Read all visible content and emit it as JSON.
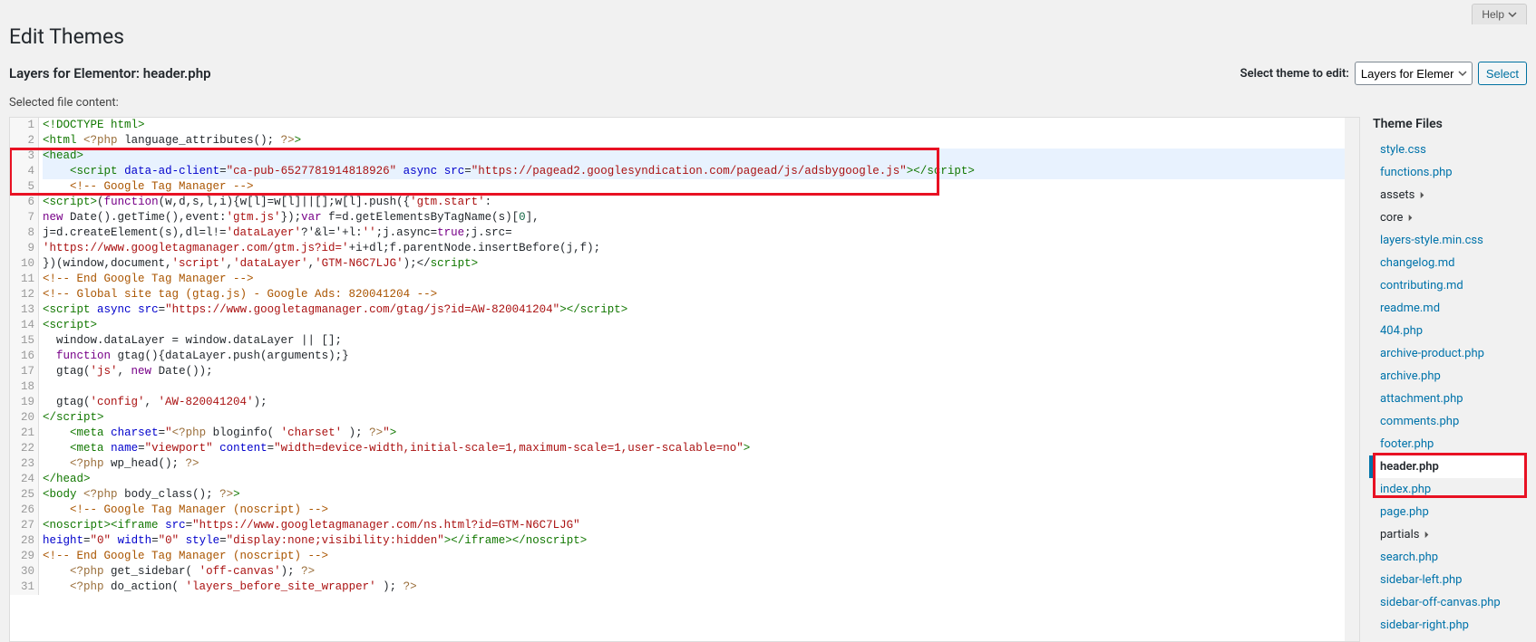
{
  "topbar": {
    "help": "Help"
  },
  "page": {
    "title": "Edit Themes",
    "subtitle": "Layers for Elementor: header.php",
    "select_label": "Select theme to edit:",
    "select_value": "Layers for Elemer",
    "select_button": "Select",
    "content_label": "Selected file content:"
  },
  "sidebar": {
    "title": "Theme Files",
    "files": [
      {
        "name": "style.css",
        "type": "file"
      },
      {
        "name": "functions.php",
        "type": "file"
      },
      {
        "name": "assets",
        "type": "folder"
      },
      {
        "name": "core",
        "type": "folder"
      },
      {
        "name": "layers-style.min.css",
        "type": "file"
      },
      {
        "name": "changelog.md",
        "type": "file"
      },
      {
        "name": "contributing.md",
        "type": "file"
      },
      {
        "name": "readme.md",
        "type": "file"
      },
      {
        "name": "404.php",
        "type": "file"
      },
      {
        "name": "archive-product.php",
        "type": "file"
      },
      {
        "name": "archive.php",
        "type": "file"
      },
      {
        "name": "attachment.php",
        "type": "file"
      },
      {
        "name": "comments.php",
        "type": "file"
      },
      {
        "name": "footer.php",
        "type": "file"
      },
      {
        "name": "header.php",
        "type": "file",
        "active": true
      },
      {
        "name": "index.php",
        "type": "file"
      },
      {
        "name": "page.php",
        "type": "file"
      },
      {
        "name": "partials",
        "type": "folder"
      },
      {
        "name": "search.php",
        "type": "file"
      },
      {
        "name": "sidebar-left.php",
        "type": "file"
      },
      {
        "name": "sidebar-off-canvas.php",
        "type": "file"
      },
      {
        "name": "sidebar-right.php",
        "type": "file"
      }
    ]
  },
  "code": {
    "lines": [
      {
        "n": 1,
        "hl": false,
        "tokens": [
          [
            "<!DOCTYPE html>",
            "cm-tag"
          ]
        ]
      },
      {
        "n": 2,
        "hl": false,
        "tokens": [
          [
            "<",
            "cm-bracket"
          ],
          [
            "html",
            "cm-tag"
          ],
          [
            " ",
            ""
          ],
          [
            "<?php",
            "cm-php"
          ],
          [
            " language_attributes(); ",
            ""
          ],
          [
            "?>",
            "cm-php"
          ],
          [
            ">",
            "cm-bracket"
          ]
        ]
      },
      {
        "n": 3,
        "hl": true,
        "tokens": [
          [
            "<",
            "cm-bracket"
          ],
          [
            "head",
            "cm-tag"
          ],
          [
            ">",
            "cm-bracket"
          ]
        ]
      },
      {
        "n": 4,
        "hl": true,
        "tokens": [
          [
            "    ",
            ""
          ],
          [
            "<",
            "cm-bracket"
          ],
          [
            "script",
            "cm-tag"
          ],
          [
            " ",
            ""
          ],
          [
            "data-ad-client",
            "cm-attr"
          ],
          [
            "=",
            ""
          ],
          [
            "\"ca-pub-6527781914818926\"",
            "cm-string"
          ],
          [
            " ",
            ""
          ],
          [
            "async",
            "cm-attr"
          ],
          [
            " ",
            ""
          ],
          [
            "src",
            "cm-attr"
          ],
          [
            "=",
            ""
          ],
          [
            "\"https://pagead2.googlesyndication.com/pagead/js/adsbygoogle.js\"",
            "cm-string"
          ],
          [
            "></",
            "cm-bracket"
          ],
          [
            "script",
            "cm-tag"
          ],
          [
            ">",
            "cm-bracket"
          ]
        ]
      },
      {
        "n": 5,
        "hl": false,
        "tokens": [
          [
            "    ",
            ""
          ],
          [
            "<!-- Google Tag Manager -->",
            "cm-comment"
          ]
        ]
      },
      {
        "n": 6,
        "hl": false,
        "tokens": [
          [
            "<",
            "cm-bracket"
          ],
          [
            "script",
            "cm-tag"
          ],
          [
            ">",
            "cm-bracket"
          ],
          [
            "(",
            ""
          ],
          [
            "function",
            "cm-kw"
          ],
          [
            "(w,d,s,l,i){w[l]=w[l]||[];w[l].push({",
            ""
          ],
          [
            "'gtm.start'",
            "cm-string"
          ],
          [
            ":",
            ""
          ]
        ]
      },
      {
        "n": 7,
        "hl": false,
        "tokens": [
          [
            "new",
            "cm-kw"
          ],
          [
            " Date().getTime(),event:",
            ""
          ],
          [
            "'gtm.js'",
            "cm-string"
          ],
          [
            "});",
            ""
          ],
          [
            "var",
            "cm-kw"
          ],
          [
            " f=d.getElementsByTagName(s)[",
            ""
          ],
          [
            "0",
            "cm-num"
          ],
          [
            "],",
            ""
          ]
        ]
      },
      {
        "n": 8,
        "hl": false,
        "tokens": [
          [
            "j=d.createElement(s),dl=l!=",
            ""
          ],
          [
            "'dataLayer'",
            "cm-string"
          ],
          [
            "?'&l='+l:",
            ""
          ],
          [
            "''",
            "cm-string"
          ],
          [
            ";j.async=",
            ""
          ],
          [
            "true",
            "cm-kw"
          ],
          [
            ";j.src=",
            ""
          ]
        ]
      },
      {
        "n": 9,
        "hl": false,
        "tokens": [
          [
            "'https://www.googletagmanager.com/gtm.js?id='",
            "cm-string"
          ],
          [
            "+i+dl;f.parentNode.insertBefore(j,f);",
            ""
          ]
        ]
      },
      {
        "n": 10,
        "hl": false,
        "tokens": [
          [
            "})(window,document,",
            ""
          ],
          [
            "'script'",
            "cm-string"
          ],
          [
            ",",
            ""
          ],
          [
            "'dataLayer'",
            "cm-string"
          ],
          [
            ",",
            ""
          ],
          [
            "'GTM-N6C7LJG'",
            "cm-string"
          ],
          [
            ");</",
            ""
          ],
          [
            "script",
            "cm-tag"
          ],
          [
            ">",
            "cm-bracket"
          ]
        ]
      },
      {
        "n": 11,
        "hl": false,
        "tokens": [
          [
            "<!-- End Google Tag Manager -->",
            "cm-comment"
          ]
        ]
      },
      {
        "n": 12,
        "hl": false,
        "tokens": [
          [
            "<!-- Global site tag (gtag.js) - Google Ads: 820041204 -->",
            "cm-comment"
          ]
        ]
      },
      {
        "n": 13,
        "hl": false,
        "tokens": [
          [
            "<",
            "cm-bracket"
          ],
          [
            "script",
            "cm-tag"
          ],
          [
            " ",
            ""
          ],
          [
            "async",
            "cm-attr"
          ],
          [
            " ",
            ""
          ],
          [
            "src",
            "cm-attr"
          ],
          [
            "=",
            ""
          ],
          [
            "\"https://www.googletagmanager.com/gtag/js?id=AW-820041204\"",
            "cm-string"
          ],
          [
            "></",
            "cm-bracket"
          ],
          [
            "script",
            "cm-tag"
          ],
          [
            ">",
            "cm-bracket"
          ]
        ]
      },
      {
        "n": 14,
        "hl": false,
        "tokens": [
          [
            "<",
            "cm-bracket"
          ],
          [
            "script",
            "cm-tag"
          ],
          [
            ">",
            "cm-bracket"
          ]
        ]
      },
      {
        "n": 15,
        "hl": false,
        "tokens": [
          [
            "  window.dataLayer = window.dataLayer || [];",
            ""
          ]
        ]
      },
      {
        "n": 16,
        "hl": false,
        "tokens": [
          [
            "  ",
            ""
          ],
          [
            "function",
            "cm-kw"
          ],
          [
            " gtag(){dataLayer.push(arguments);}",
            ""
          ]
        ]
      },
      {
        "n": 17,
        "hl": false,
        "tokens": [
          [
            "  gtag(",
            ""
          ],
          [
            "'js'",
            "cm-string"
          ],
          [
            ", ",
            ""
          ],
          [
            "new",
            "cm-kw"
          ],
          [
            " Date());",
            ""
          ]
        ]
      },
      {
        "n": 18,
        "hl": false,
        "tokens": [
          [
            "",
            ""
          ]
        ]
      },
      {
        "n": 19,
        "hl": false,
        "tokens": [
          [
            "  gtag(",
            ""
          ],
          [
            "'config'",
            "cm-string"
          ],
          [
            ", ",
            ""
          ],
          [
            "'AW-820041204'",
            "cm-string"
          ],
          [
            ");",
            ""
          ]
        ]
      },
      {
        "n": 20,
        "hl": false,
        "tokens": [
          [
            "</",
            "cm-bracket"
          ],
          [
            "script",
            "cm-tag"
          ],
          [
            ">",
            "cm-bracket"
          ]
        ]
      },
      {
        "n": 21,
        "hl": false,
        "tokens": [
          [
            "    ",
            ""
          ],
          [
            "<",
            "cm-bracket"
          ],
          [
            "meta",
            "cm-tag"
          ],
          [
            " ",
            ""
          ],
          [
            "charset",
            "cm-attr"
          ],
          [
            "=",
            ""
          ],
          [
            "\"",
            "cm-string"
          ],
          [
            "<?php",
            "cm-php"
          ],
          [
            " bloginfo( ",
            ""
          ],
          [
            "'charset'",
            "cm-string"
          ],
          [
            " ); ",
            ""
          ],
          [
            "?>",
            "cm-php"
          ],
          [
            "\"",
            "cm-string"
          ],
          [
            ">",
            "cm-bracket"
          ]
        ]
      },
      {
        "n": 22,
        "hl": false,
        "tokens": [
          [
            "    ",
            ""
          ],
          [
            "<",
            "cm-bracket"
          ],
          [
            "meta",
            "cm-tag"
          ],
          [
            " ",
            ""
          ],
          [
            "name",
            "cm-attr"
          ],
          [
            "=",
            ""
          ],
          [
            "\"viewport\"",
            "cm-string"
          ],
          [
            " ",
            ""
          ],
          [
            "content",
            "cm-attr"
          ],
          [
            "=",
            ""
          ],
          [
            "\"width=device-width,initial-scale=1,maximum-scale=1,user-scalable=no\"",
            "cm-string"
          ],
          [
            ">",
            "cm-bracket"
          ]
        ]
      },
      {
        "n": 23,
        "hl": false,
        "tokens": [
          [
            "    ",
            ""
          ],
          [
            "<?php",
            "cm-php"
          ],
          [
            " wp_head(); ",
            ""
          ],
          [
            "?>",
            "cm-php"
          ]
        ]
      },
      {
        "n": 24,
        "hl": false,
        "tokens": [
          [
            "</",
            "cm-bracket"
          ],
          [
            "head",
            "cm-tag"
          ],
          [
            ">",
            "cm-bracket"
          ]
        ]
      },
      {
        "n": 25,
        "hl": false,
        "tokens": [
          [
            "<",
            "cm-bracket"
          ],
          [
            "body",
            "cm-tag"
          ],
          [
            " ",
            ""
          ],
          [
            "<?php",
            "cm-php"
          ],
          [
            " body_class(); ",
            ""
          ],
          [
            "?>",
            "cm-php"
          ],
          [
            ">",
            "cm-bracket"
          ]
        ]
      },
      {
        "n": 26,
        "hl": false,
        "tokens": [
          [
            "    ",
            ""
          ],
          [
            "<!-- Google Tag Manager (noscript) -->",
            "cm-comment"
          ]
        ]
      },
      {
        "n": 27,
        "hl": false,
        "tokens": [
          [
            "<",
            "cm-bracket"
          ],
          [
            "noscript",
            "cm-tag"
          ],
          [
            "><",
            "cm-bracket"
          ],
          [
            "iframe",
            "cm-tag"
          ],
          [
            " ",
            ""
          ],
          [
            "src",
            "cm-attr"
          ],
          [
            "=",
            ""
          ],
          [
            "\"https://www.googletagmanager.com/ns.html?id=GTM-N6C7LJG\"",
            "cm-string"
          ]
        ]
      },
      {
        "n": 28,
        "hl": false,
        "tokens": [
          [
            "height",
            "cm-attr"
          ],
          [
            "=",
            ""
          ],
          [
            "\"0\"",
            "cm-string"
          ],
          [
            " ",
            ""
          ],
          [
            "width",
            "cm-attr"
          ],
          [
            "=",
            ""
          ],
          [
            "\"0\"",
            "cm-string"
          ],
          [
            " ",
            ""
          ],
          [
            "style",
            "cm-attr"
          ],
          [
            "=",
            ""
          ],
          [
            "\"display:none;visibility:hidden\"",
            "cm-string"
          ],
          [
            "></",
            "cm-bracket"
          ],
          [
            "iframe",
            "cm-tag"
          ],
          [
            "></",
            "cm-bracket"
          ],
          [
            "noscript",
            "cm-tag"
          ],
          [
            ">",
            "cm-bracket"
          ]
        ]
      },
      {
        "n": 29,
        "hl": false,
        "tokens": [
          [
            "<!-- End Google Tag Manager (noscript) -->",
            "cm-comment"
          ]
        ]
      },
      {
        "n": 30,
        "hl": false,
        "tokens": [
          [
            "    ",
            ""
          ],
          [
            "<?php",
            "cm-php"
          ],
          [
            " get_sidebar( ",
            ""
          ],
          [
            "'off-canvas'",
            "cm-string"
          ],
          [
            "); ",
            ""
          ],
          [
            "?>",
            "cm-php"
          ]
        ]
      },
      {
        "n": 31,
        "hl": false,
        "tokens": [
          [
            "    ",
            ""
          ],
          [
            "<?php",
            "cm-php"
          ],
          [
            " do_action( ",
            ""
          ],
          [
            "'layers_before_site_wrapper'",
            "cm-string"
          ],
          [
            " ); ",
            ""
          ],
          [
            "?>",
            "cm-php"
          ]
        ]
      }
    ]
  }
}
